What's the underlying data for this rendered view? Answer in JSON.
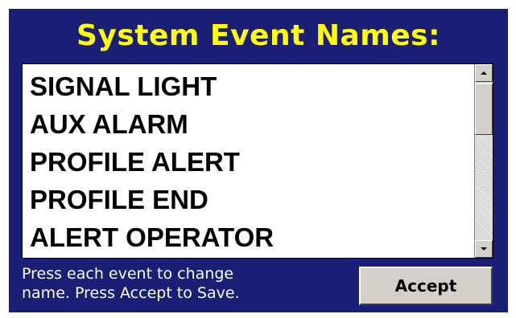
{
  "title": "System Event Names:",
  "events": [
    {
      "label": "SIGNAL LIGHT"
    },
    {
      "label": "AUX ALARM"
    },
    {
      "label": "PROFILE ALERT"
    },
    {
      "label": "PROFILE END"
    },
    {
      "label": "ALERT OPERATOR"
    }
  ],
  "instructions": {
    "line1": "Press each event to change",
    "line2": "name. Press Accept to Save."
  },
  "accept_button": {
    "label": "Accept"
  },
  "scrollbar": {
    "up_icon": "arrow-up-icon",
    "down_icon": "arrow-down-icon",
    "position": 0
  },
  "colors": {
    "panel_background": "#1a1f75",
    "title_text": "#ffff00",
    "instruction_text": "#ffffff",
    "list_background": "#ffffff",
    "button_face": "#d4d0c8"
  }
}
